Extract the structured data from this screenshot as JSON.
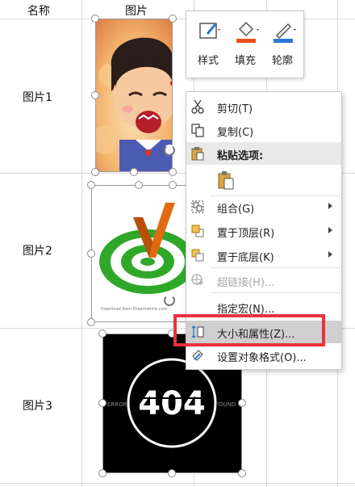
{
  "sheet": {
    "headers": [
      "名称",
      "图片"
    ],
    "rows": [
      {
        "name": "图片1"
      },
      {
        "name": "图片2"
      },
      {
        "name": "图片3"
      }
    ]
  },
  "pictures": {
    "img3_left_text": "ERROR",
    "img3_right_text": "FOUND",
    "img3_code": "404",
    "img2_caption": "Download from Dreamstime.com"
  },
  "mini_toolbar": {
    "style_label": "样式",
    "fill_label": "填充",
    "outline_label": "轮廓",
    "fill_color": "#e8501e",
    "outline_color": "#2b78d6"
  },
  "context_menu": {
    "items": [
      {
        "label": "剪切(T)",
        "icon": "scissors-icon"
      },
      {
        "label": "复制(C)",
        "icon": "copy-icon"
      },
      {
        "label": "粘贴选项:",
        "icon": "paste-icon"
      },
      {
        "label": "",
        "icon": "paste-option-icon"
      },
      {
        "label": "组合(G)",
        "icon": "group-icon"
      },
      {
        "label": "置于顶层(R)",
        "icon": "bring-to-front-icon"
      },
      {
        "label": "置于底层(K)",
        "icon": "send-to-back-icon"
      },
      {
        "label": "超链接(H)...",
        "icon": "hyperlink-icon"
      },
      {
        "label": "指定宏(N)...",
        "icon": ""
      },
      {
        "label": "大小和属性(Z)...",
        "icon": "size-properties-icon"
      },
      {
        "label": "设置对象格式(O)...",
        "icon": "format-object-icon"
      }
    ]
  }
}
